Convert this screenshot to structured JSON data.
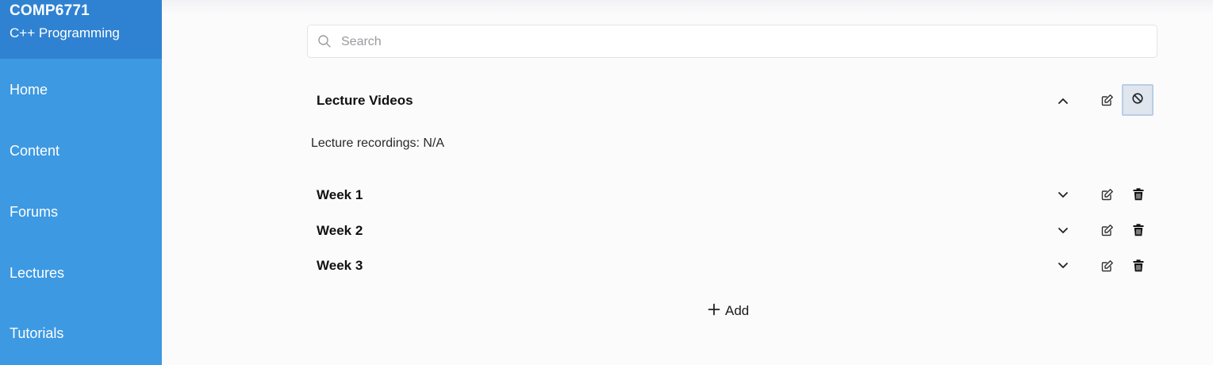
{
  "sidebar": {
    "course_code": "COMP6771",
    "course_name": "C++ Programming",
    "items": [
      {
        "label": "Home"
      },
      {
        "label": "Content"
      },
      {
        "label": "Forums"
      },
      {
        "label": "Lectures"
      },
      {
        "label": "Tutorials"
      }
    ]
  },
  "search": {
    "placeholder": "Search",
    "value": ""
  },
  "section": {
    "title": "Lecture Videos",
    "description": "Lecture recordings: N/A",
    "expanded": true
  },
  "weeks": [
    {
      "title": "Week 1"
    },
    {
      "title": "Week 2"
    },
    {
      "title": "Week 3"
    }
  ],
  "add_label": "Add",
  "colors": {
    "sidebar": "#3d99e2",
    "sidebar_header": "#2f82d2",
    "active_toggle_border": "#b9cde6"
  },
  "icons": {
    "search": "search-icon",
    "collapse": "chevron-up-icon",
    "expand": "chevron-down-icon",
    "edit": "edit-icon",
    "cancel": "cancel-icon",
    "delete": "trash-icon",
    "add": "plus-icon"
  }
}
